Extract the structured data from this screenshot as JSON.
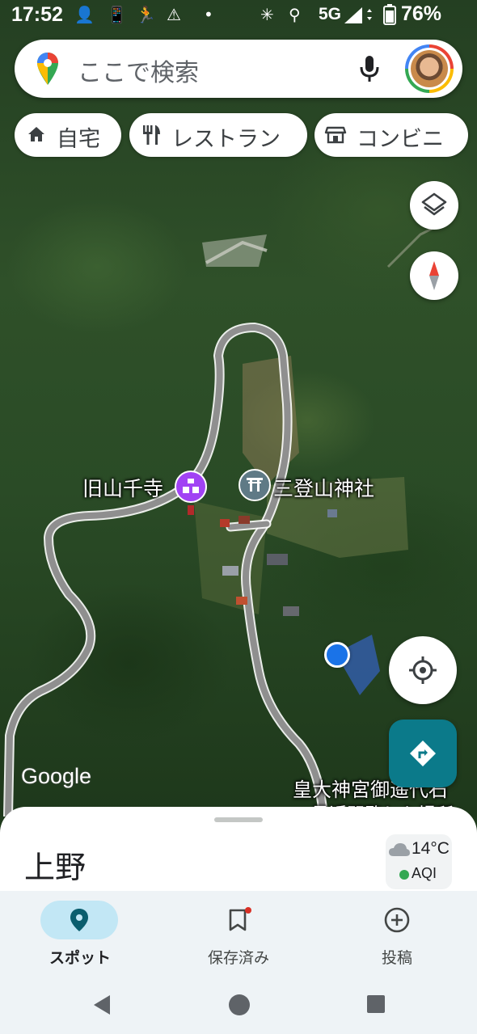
{
  "status_bar": {
    "time": "17:52",
    "network": "5G",
    "battery": "76%"
  },
  "search": {
    "placeholder": "ここで検索"
  },
  "chips": [
    {
      "label": "自宅",
      "icon": "home-icon"
    },
    {
      "label": "レストラン",
      "icon": "restaurant-icon"
    },
    {
      "label": "コンビニ",
      "icon": "store-icon"
    }
  ],
  "map": {
    "labels": {
      "temple": "旧山千寺",
      "shrine": "三登山神社",
      "bottom_text_1": "皇大神宮御遥代石",
      "bottom_text_2": "最近閲覧した場所"
    },
    "attribution": "Google"
  },
  "sheet": {
    "place": "上野",
    "weather": {
      "temp": "14°C",
      "aqi": "AQI"
    }
  },
  "bottom_nav": [
    {
      "label": "スポット",
      "icon": "pin-icon",
      "active": true
    },
    {
      "label": "保存済み",
      "icon": "bookmark-icon",
      "active": false
    },
    {
      "label": "投稿",
      "icon": "add-circle-icon",
      "active": false
    }
  ],
  "colors": {
    "accent": "#0b7a8a",
    "active_pill": "#c2e7f5",
    "location_dot": "#1a73e8"
  }
}
